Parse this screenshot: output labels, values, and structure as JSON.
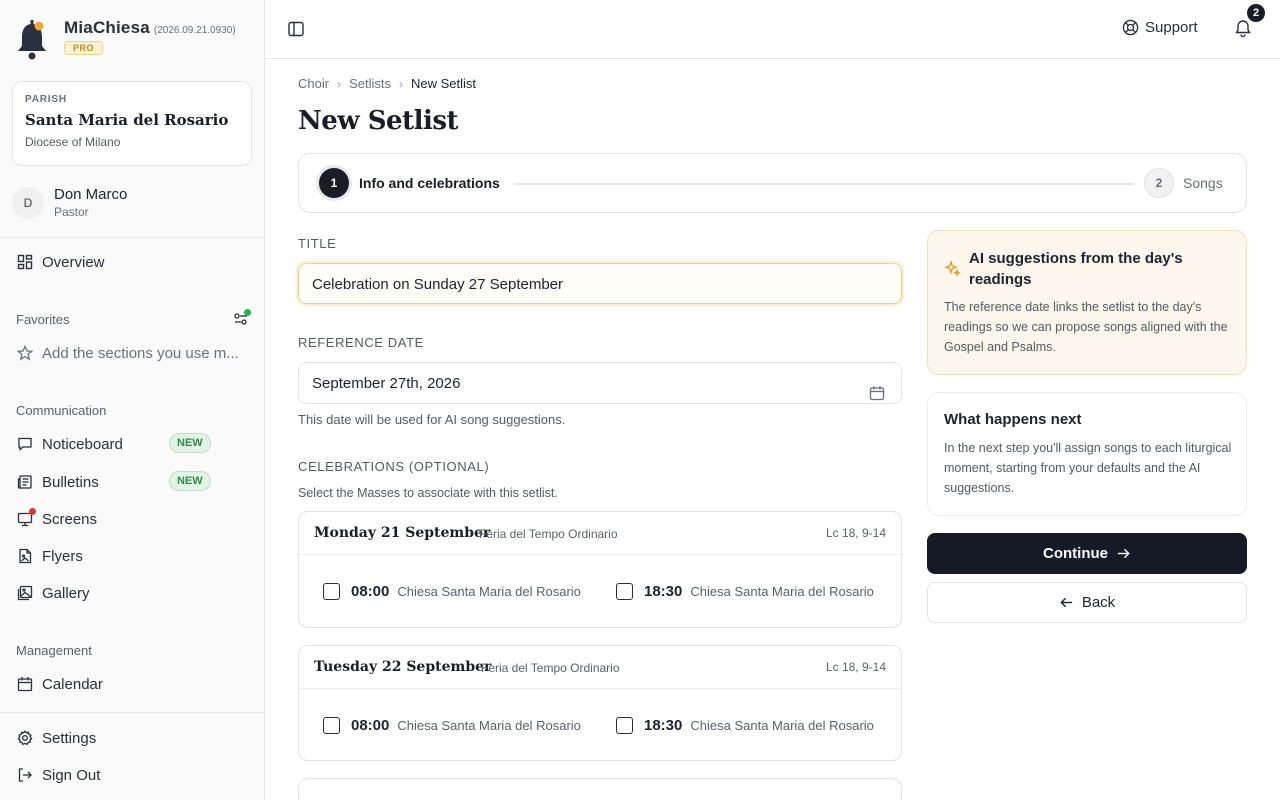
{
  "brand": {
    "name": "MiaChiesa",
    "version": "(2026.09.21.0930)",
    "plan_badge": "PRO"
  },
  "parish": {
    "kicker": "PARISH",
    "name": "Santa Maria del Rosario",
    "diocese": "Diocese of Milano"
  },
  "user": {
    "initial": "D",
    "name": "Don Marco",
    "role": "Pastor"
  },
  "sidebar": {
    "overview_label": "Overview",
    "favorites_label": "Favorites",
    "favorites_placeholder": "Add the sections you use m...",
    "communication_label": "Communication",
    "communication_items": [
      {
        "label": "Noticeboard",
        "badge": "NEW"
      },
      {
        "label": "Bulletins",
        "badge": "NEW"
      },
      {
        "label": "Screens"
      },
      {
        "label": "Flyers"
      },
      {
        "label": "Gallery"
      }
    ],
    "management_label": "Management",
    "calendar_label": "Calendar",
    "settings_label": "Settings",
    "signout_label": "Sign Out"
  },
  "topbar": {
    "support_label": "Support",
    "notification_count": "2"
  },
  "breadcrumb": [
    "Choir",
    "Setlists",
    "New Setlist"
  ],
  "page_title": "New Setlist",
  "stepper": {
    "steps": [
      {
        "number": "1",
        "label": "Info and celebrations",
        "active": true
      },
      {
        "number": "2",
        "label": "Songs",
        "active": false
      }
    ]
  },
  "form": {
    "title_label": "TITLE",
    "title_value": "Celebration on Sunday 27 September",
    "date_label": "REFERENCE DATE",
    "date_value": "September 27th, 2026",
    "date_hint": "This date will be used for AI song suggestions.",
    "celebrations_label": "CELEBRATIONS (OPTIONAL)",
    "celebrations_hint": "Select the Masses to associate with this setlist."
  },
  "days": [
    {
      "title": "Monday 21 September",
      "feria": "Feria del Tempo Ordinario",
      "reading": "Lc 18, 9-14",
      "masses": [
        {
          "time": "08:00",
          "place": "Chiesa Santa Maria del Rosario",
          "checked": false
        },
        {
          "time": "18:30",
          "place": "Chiesa Santa Maria del Rosario",
          "checked": false
        }
      ]
    },
    {
      "title": "Tuesday 22 September",
      "feria": "Feria del Tempo Ordinario",
      "reading": "Lc 18, 9-14",
      "masses": [
        {
          "time": "08:00",
          "place": "Chiesa Santa Maria del Rosario",
          "checked": false
        },
        {
          "time": "18:30",
          "place": "Chiesa Santa Maria del Rosario",
          "checked": false
        }
      ]
    }
  ],
  "ai_card": {
    "title": "AI suggestions from the day's readings",
    "body": "The reference date links the setlist to the day's readings so we can propose songs aligned with the Gospel and Psalms."
  },
  "next_card": {
    "title": "What happens next",
    "body": "In the next step you'll assign songs to each liturgical moment, starting from your defaults and the AI suggestions."
  },
  "actions": {
    "continue_label": "Continue",
    "back_label": "Back"
  },
  "colors": {
    "primary": "#161a26",
    "accent": "#f0cf92",
    "new_badge": "#2f8a4a",
    "alert_dot": "#e0333a"
  }
}
